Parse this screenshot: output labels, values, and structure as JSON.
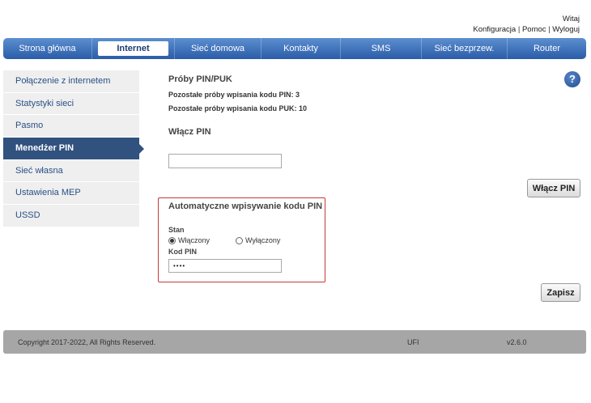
{
  "header": {
    "greeting": "Witaj",
    "links": [
      "Konfiguracja",
      "Pomoc",
      "Wyloguj"
    ]
  },
  "nav": {
    "items": [
      {
        "label": "Strona główna"
      },
      {
        "label": "Internet",
        "active": true
      },
      {
        "label": "Sieć domowa"
      },
      {
        "label": "Kontakty"
      },
      {
        "label": "SMS"
      },
      {
        "label": "Sieć bezprzew."
      },
      {
        "label": "Router"
      }
    ]
  },
  "sidebar": {
    "items": [
      {
        "label": "Połączenie z internetem"
      },
      {
        "label": "Statystyki sieci"
      },
      {
        "label": "Pasmo"
      },
      {
        "label": "Menedżer PIN",
        "active": true
      },
      {
        "label": "Sieć własna"
      },
      {
        "label": "Ustawienia MEP"
      },
      {
        "label": "USSD"
      }
    ]
  },
  "main": {
    "attempts_title": "Próby PIN/PUK",
    "pin_attempts": "Pozostałe próby wpisania kodu PIN: 3",
    "puk_attempts": "Pozostałe próby wpisania kodu PUK: 10",
    "enable_pin_title": "Włącz PIN",
    "pin_input_value": "",
    "enable_pin_button": "Włącz PIN",
    "auto_title": "Automatyczne wpisywanie kodu PIN",
    "state_label": "Stan",
    "radio_on": "Włączony",
    "radio_off": "Wyłączony",
    "state_selected": "Włączony",
    "pin_code_label": "Kod PIN",
    "pin_code_value": "••••",
    "save_button": "Zapisz",
    "help_icon_text": "?"
  },
  "footer": {
    "copyright": "Copyright 2017-2022, All Rights Reserved.",
    "device": "UFI",
    "version": "v2.6.0"
  },
  "colors": {
    "nav_top": "#5d8fd0",
    "nav_bottom": "#2a5ca8",
    "sidebar_active": "#31527f",
    "highlight_border": "#c23a3a"
  }
}
